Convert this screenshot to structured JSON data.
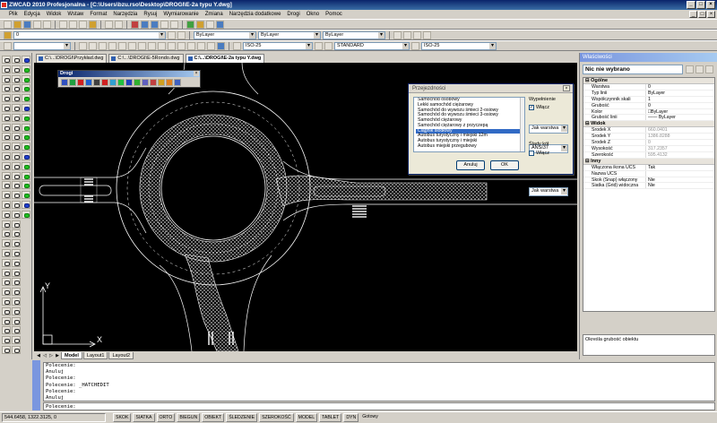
{
  "window": {
    "title": "ZWCAD 2010 Profesjonalna - [C:\\Users\\bzu.rso\\Desktop\\DROGI\\E-2a typu Y.dwg]",
    "controls": [
      "_",
      "□",
      "×"
    ]
  },
  "menu": [
    "Plik",
    "Edycja",
    "Widok",
    "Wstaw",
    "Format",
    "Narzędzia",
    "Rysuj",
    "Wymiarowanie",
    "Zmiana",
    "Narzędzia dodatkowe",
    "Drogi",
    "Okno",
    "Pomoc"
  ],
  "toolbar": {
    "layer_combo": "0",
    "color_combo": "ByLayer",
    "linetype_combo": "ByLayer",
    "lineweight_combo": "ByLayer",
    "textstyle_combo": "ISO-25",
    "dimstyle_combo": "STANDARD",
    "dimstyle2_combo": "ISO-25"
  },
  "doc_tabs": [
    {
      "label": "C:\\...\\DROGI\\Przykład.dwg",
      "active": false
    },
    {
      "label": "C:\\...\\DROGI\\E-5Rondo.dwg",
      "active": false
    },
    {
      "label": "C:\\...\\DROGI\\E-2a typu Y.dwg",
      "active": true
    }
  ],
  "layout_tabs": [
    {
      "label": "Model",
      "active": true
    },
    {
      "label": "Layout1",
      "active": false
    },
    {
      "label": "Layout2",
      "active": false
    }
  ],
  "drogi_toolbar": {
    "title": "Drogi",
    "icon_colors": [
      "#3050c0",
      "#20a040",
      "#d02020",
      "#2060d0",
      "#404040",
      "#d02020",
      "#30a0d0",
      "#20c040",
      "#2040c0",
      "#30b030",
      "#6060c0",
      "#c04040",
      "#d0a020",
      "#e08020",
      "#4060c0"
    ]
  },
  "dialog": {
    "title": "Przejezdności",
    "vehicles": [
      "Samochód osobowy",
      "Lekki samochód ciężarowy",
      "Samochód do wywozu śmieci 2-osiowy",
      "Samochód do wywozu śmieci 3-osiowy",
      "Samochód ciężarowy",
      "Samochód ciężarowy z przyczepą",
      "Ciągnik siodłowy",
      "Autobus turystyczny i miejski 12m",
      "Autobus turystyczny i miejski",
      "Autobus miejski przegubowy"
    ],
    "selected_index": 6,
    "fill_group": "Wypełnienie",
    "fill_checkbox_label": "Włącz",
    "fill_checked": true,
    "fill_layer_combo": "Jak warstwa",
    "fill_pattern_combo": "ANSI37",
    "wheel_group": "Ślady kół",
    "wheel_checkbox_label": "Włącz",
    "wheel_checked": false,
    "wheel_layer_combo": "Jak warstwa",
    "cancel_label": "Anuluj",
    "ok_label": "OK"
  },
  "properties": {
    "title": "Właściwości",
    "selection": "Nic nie wybrano",
    "categories": [
      {
        "name": "Ogólne",
        "rows": [
          {
            "key": "Warstwa",
            "value": "0"
          },
          {
            "key": "Typ linii",
            "value": "ByLayer"
          },
          {
            "key": "Współczynnik skali",
            "value": "1"
          },
          {
            "key": "Grubość",
            "value": "0"
          },
          {
            "key": "Kolor",
            "value": "□ByLayer"
          },
          {
            "key": "Grubość linii",
            "value": "—— ByLayer"
          }
        ]
      },
      {
        "name": "Widok",
        "rows": [
          {
            "key": "Środek X",
            "value": "660.0401",
            "grey": true
          },
          {
            "key": "Środek Y",
            "value": "1386.8288",
            "grey": true
          },
          {
            "key": "Środek Z",
            "value": "0",
            "grey": true
          },
          {
            "key": "Wysokość",
            "value": "317.2357",
            "grey": true
          },
          {
            "key": "Szerokość",
            "value": "595.4132",
            "grey": true
          }
        ]
      },
      {
        "name": "Inny",
        "rows": [
          {
            "key": "Włączona ikona UCS",
            "value": "Tak"
          },
          {
            "key": "Nazwa UCS",
            "value": ""
          },
          {
            "key": "Skok (Snap) włączony",
            "value": "Nie"
          },
          {
            "key": "Siatka (Grid) widoczna",
            "value": "Nie"
          }
        ]
      }
    ],
    "description": "Określa grubość obiektu"
  },
  "command": {
    "history": [
      "Polecenie:",
      "Anuluj",
      "Polecenie:",
      "Polecenie: _HATCHEDIT",
      "Polecenie:",
      "Anuluj"
    ],
    "input": "Polecenie:"
  },
  "status": {
    "coords": "544.6458,  1322.3125,  0",
    "buttons": [
      "SKOK",
      "SIATKA",
      "ORTO",
      "BIEGUN",
      "OBIEKT",
      "ŚLEDZENIE",
      "SZEROKOŚĆ",
      "MODEL",
      "TABLET",
      "DYN"
    ],
    "ready": "Gotowy"
  },
  "axis": {
    "x_label": "X",
    "y_label": "Y"
  }
}
